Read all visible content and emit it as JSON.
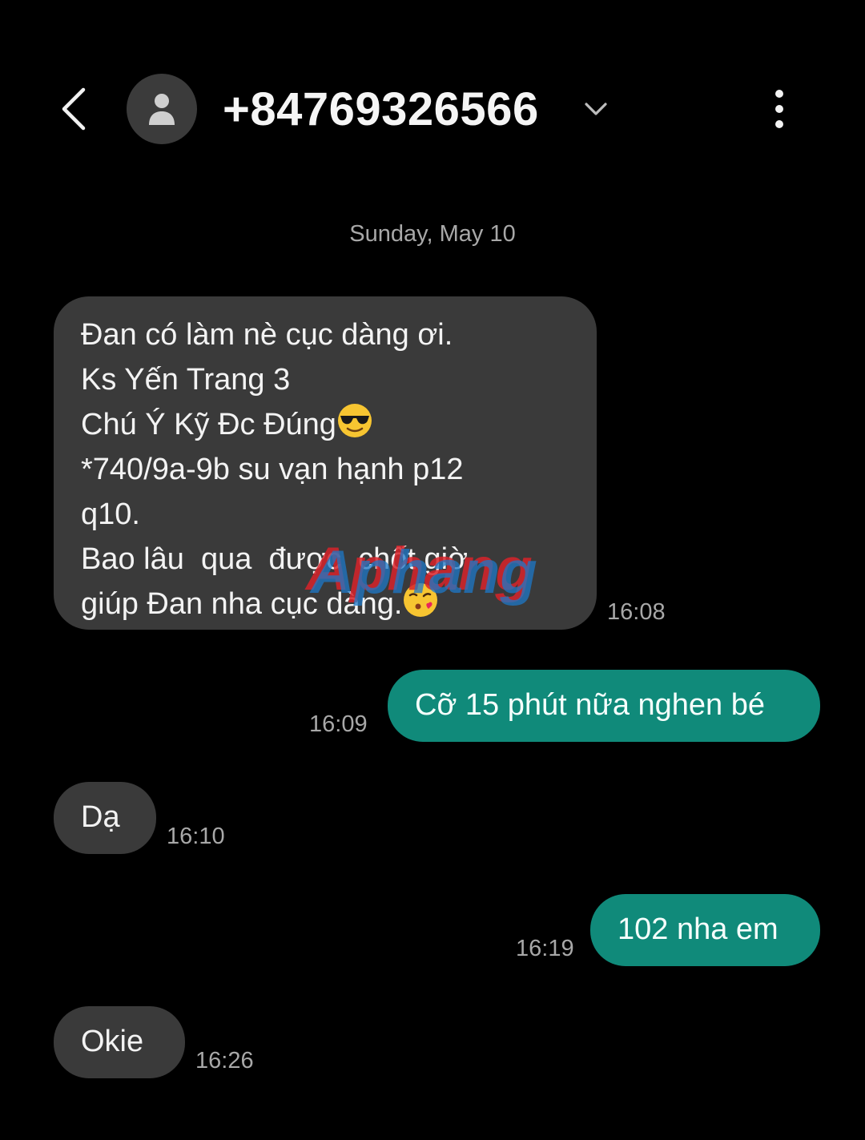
{
  "header": {
    "back_icon": "chevron-left-icon",
    "avatar_icon": "person-icon",
    "contact_number": "+84769326566",
    "expand_icon": "chevron-down-icon",
    "more_icon": "more-vertical-icon"
  },
  "conversation": {
    "date_label": "Sunday, May 10",
    "messages": [
      {
        "direction": "incoming",
        "lines": [
          "Đan có làm nè cục dàng ơi.",
          "Ks Yến Trang 3",
          "Chú Ý Kỹ Đc Đúng",
          "*740/9a-9b su vạn hạnh p12",
          "q10.",
          "Bao lâu  qua  được  chốt giờ",
          "giúp Đan nha cục dàng."
        ],
        "time": "16:08"
      },
      {
        "direction": "outgoing",
        "text": "Cỡ 15 phút nữa nghen bé",
        "time": "16:09"
      },
      {
        "direction": "incoming",
        "text": "Dạ",
        "time": "16:10"
      },
      {
        "direction": "outgoing",
        "text": "102 nha em",
        "time": "16:19"
      },
      {
        "direction": "incoming",
        "text": "Okie",
        "time": "16:26"
      }
    ]
  },
  "watermark": {
    "text": "Aphang"
  },
  "colors": {
    "background": "#000000",
    "incoming_bubble": "#3a3a3a",
    "outgoing_bubble": "#108a7a",
    "timestamp": "#a8a8a8"
  }
}
